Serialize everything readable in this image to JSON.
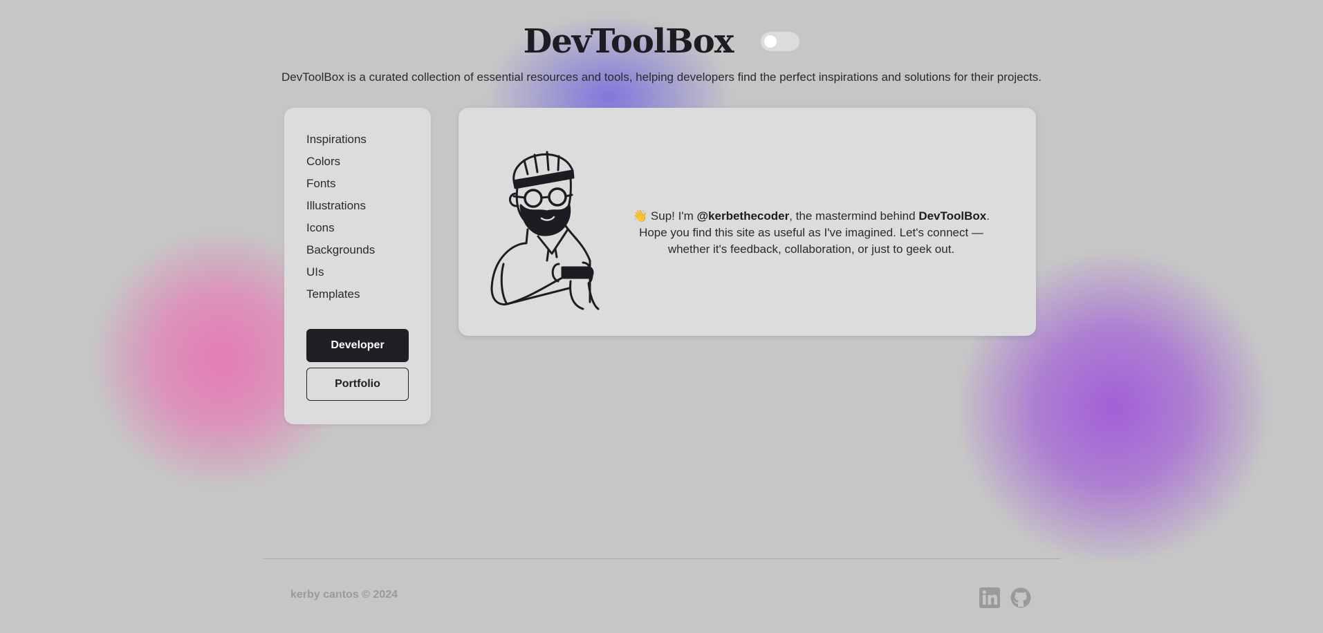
{
  "header": {
    "title": "DevToolBox",
    "tagline": "DevToolBox is a curated collection of essential resources and tools, helping developers find the perfect inspirations and solutions for their projects.",
    "theme_toggle": {
      "state": "off"
    }
  },
  "sidebar": {
    "items": [
      {
        "label": "Inspirations"
      },
      {
        "label": "Colors"
      },
      {
        "label": "Fonts"
      },
      {
        "label": "Illustrations"
      },
      {
        "label": "Icons"
      },
      {
        "label": "Backgrounds"
      },
      {
        "label": "UIs"
      },
      {
        "label": "Templates"
      }
    ],
    "developer_button": "Developer",
    "portfolio_button": "Portfolio"
  },
  "intro": {
    "emoji": "👋",
    "greeting": " Sup! I'm ",
    "handle": "@kerbethecoder",
    "middle": ", the mastermind behind ",
    "brand": "DevToolBox",
    "rest": ". Hope you find this site as useful as I've imagined. Let's connect — whether it's feedback, collaboration, or just to geek out."
  },
  "footer": {
    "copyright": "kerby cantos © 2024",
    "icons": [
      "linkedin-icon",
      "github-icon"
    ]
  },
  "colors": {
    "background": "#c6c6c6",
    "card": "#dcdcdc",
    "primary_button": "#1f1f24",
    "blob_pink": "#e678b4",
    "blob_purple": "#a05ad7",
    "blob_blue": "#786edc"
  }
}
